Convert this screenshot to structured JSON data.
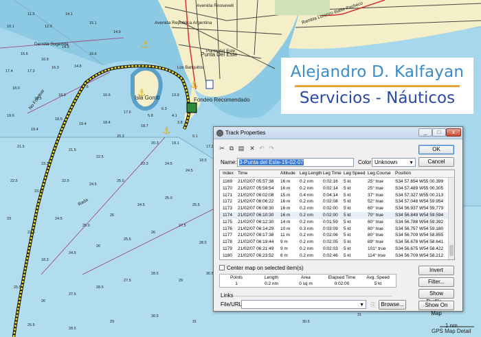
{
  "map": {
    "streets": [
      "Avenida Roosevelt",
      "Avenida Republica Argentina",
      "Punta Del Este",
      "Punta del Este",
      "Rambla Lorenzo Batlle Pacheco",
      "Los Banquitos"
    ],
    "places": [
      "Derrota Sugerida",
      "No Fondear",
      "Isla Gorriti",
      "Fondeo Recomendado",
      "Rada"
    ],
    "soundings": [
      "10.1",
      "11.3",
      "12.9",
      "15.1",
      "14.9",
      "14.1",
      "15.6",
      "16.9",
      "17.4",
      "18.0",
      "17.2",
      "16.3",
      "13.9",
      "18.5",
      "19.6",
      "19.4",
      "18.3",
      "21.5",
      "23.3",
      "23.5",
      "24.5",
      "25.5",
      "25.0",
      "27.5",
      "28.5",
      "30.5",
      "31",
      "29",
      "22.5",
      "26",
      "18.4",
      "17.6",
      "16.6",
      "14.8",
      "6.3",
      "4.1",
      "3.8",
      "5.8",
      "9.1",
      "18.7",
      "20.3"
    ],
    "scale_label": "1 nm",
    "scale_value": "29",
    "footer": "GPS Map Detail"
  },
  "logo": {
    "line1": "Alejandro D. Kalfayan",
    "line2": "Servicios - Náuticos",
    "accent_color": "#e8a23a"
  },
  "dialog": {
    "title": "Track Properties",
    "window_buttons": [
      "_",
      "□",
      "x"
    ],
    "toolbar_icons": [
      "cut-icon",
      "copy-icon",
      "paste-icon",
      "delete-icon",
      "undo-icon",
      "redo-icon"
    ],
    "name_label": "Name:",
    "name_value": "3-Punta del Este-19-02-07",
    "color_label": "Color:",
    "color_value": "Unknown",
    "ok_label": "OK",
    "cancel_label": "Cancel",
    "columns": [
      "Index",
      "Time",
      "Altitude",
      "Leg Length",
      "Leg Time",
      "Leg Speed",
      "Leg Course",
      "Position"
    ],
    "rows": [
      [
        "1169",
        "21/02/07 05:57:38",
        "16 m",
        "0.2 nm",
        "0:02:16",
        "5 kt",
        "25° true",
        "S34 57.654 W55 00.399"
      ],
      [
        "1170",
        "21/02/07 05:59:54",
        "16 m",
        "0.2 nm",
        "0:02:14",
        "5 kt",
        "25° true",
        "S34 57.489 W55 00.305"
      ],
      [
        "1171",
        "21/02/07 06:02:08",
        "15 m",
        "0.4 nm",
        "0:04:14",
        "5 kt",
        "37° true",
        "S34 57.327 W55 00.213"
      ],
      [
        "1172",
        "21/02/07 06:06:22",
        "16 m",
        "0.2 nm",
        "0:02:08",
        "5 kt",
        "52° true",
        "S34 57.048 W54 59.954"
      ],
      [
        "1173",
        "21/02/07 06:08:30",
        "16 m",
        "0.2 nm",
        "0:02:00",
        "5 kt",
        "60° true",
        "S34 56.937 W54 59.779"
      ],
      [
        "1174",
        "21/02/07 06:10:30",
        "16 m",
        "0.2 nm",
        "0:02:00",
        "5 kt",
        "70° true",
        "S34 56.849 W54 59.594"
      ],
      [
        "1175",
        "21/02/07 06:12:30",
        "14 m",
        "0.2 nm",
        "0:01:59",
        "5 kt",
        "80° true",
        "S34 56.788 W54 59.392"
      ],
      [
        "1176",
        "21/02/07 06:14:29",
        "10 m",
        "0.3 nm",
        "0:03:09",
        "5 kt",
        "80° true",
        "S34 56.757 W54 59.180"
      ],
      [
        "1177",
        "21/02/07 06:17:38",
        "11 m",
        "0.2 nm",
        "0:02:06",
        "5 kt",
        "80° true",
        "S34 56.709 W54 58.855"
      ],
      [
        "1178",
        "21/02/07 06:19:44",
        "9 m",
        "0.2 nm",
        "0:02:05",
        "5 kt",
        "89° true",
        "S34 56.678 W54 58.641"
      ],
      [
        "1179",
        "21/02/07 06:21:49",
        "9 m",
        "0.2 nm",
        "0:02:03",
        "5 kt",
        "101° true",
        "S34 56.675 W54 58.422"
      ],
      [
        "1180",
        "21/02/07 06:23:52",
        "6 m",
        "0.2 nm",
        "0:02:46",
        "5 kt",
        "114° true",
        "S34 56.709 W54 58.212"
      ]
    ],
    "highlight_row": "1174",
    "center_map_label": "Center map on selected item(s)",
    "invert_label": "Invert",
    "filter_label": "Filter...",
    "show_profile_label": "Show Profile...",
    "show_on_map_label": "Show On Map",
    "stats_headers": [
      "Points",
      "Length",
      "Area",
      "Elapsed Time",
      "Avg. Speed"
    ],
    "stats_values": [
      "1",
      "0.2 nm",
      "0 sq m",
      "0:02:00",
      "5 kt"
    ],
    "links_label": "Links",
    "file_url_label": "File/URL:",
    "browse_label": "Browse..."
  }
}
